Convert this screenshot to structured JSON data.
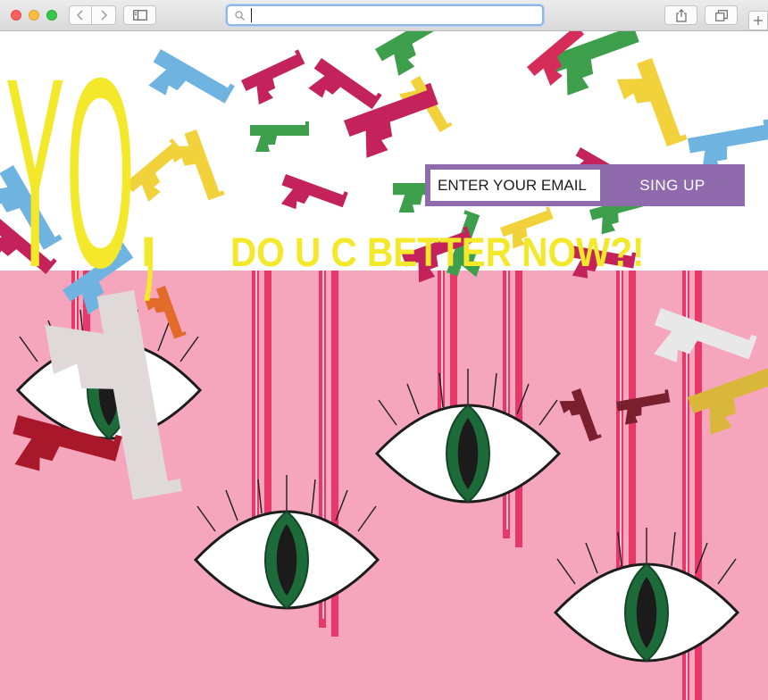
{
  "browser": {
    "url_value": "",
    "icons": [
      "back-chevron-icon",
      "forward-chevron-icon",
      "sidebar-icon",
      "search-icon",
      "share-icon",
      "tabs-icon",
      "plus-icon"
    ]
  },
  "hero": {
    "headline": "YO,",
    "tagline": "DO U C BETTER NOW?!"
  },
  "signup": {
    "email_placeholder": "ENTER YOUR EMAIL",
    "button_label": "SING UP"
  },
  "colors": {
    "headline": "#f4e82a",
    "pink_background": "#f5a6bd",
    "signup_purple": "#8f6aad",
    "iris_green": "#1e6b3a",
    "drip_red": "#e8386a"
  }
}
